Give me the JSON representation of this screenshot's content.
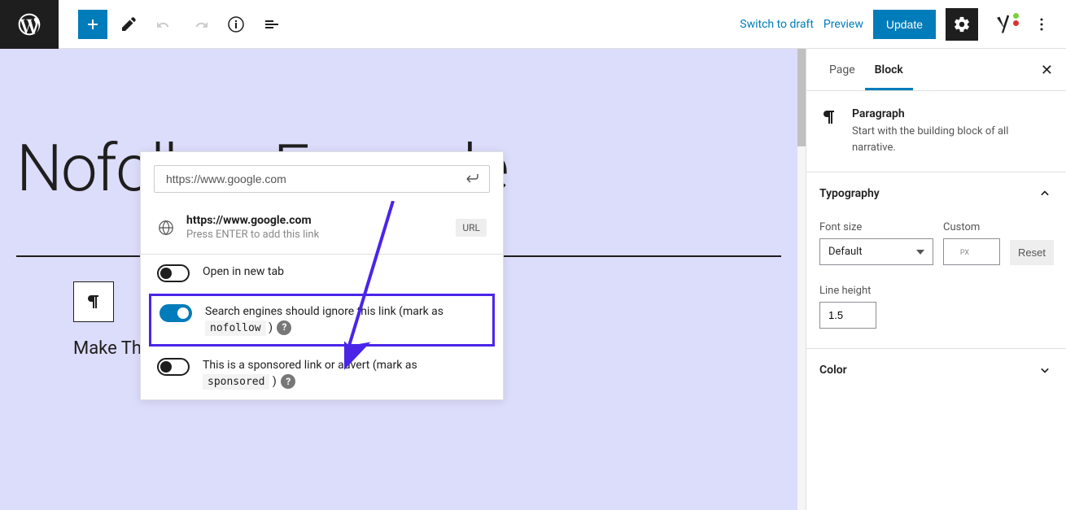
{
  "toolbar": {
    "switch_to_draft": "Switch to draft",
    "preview": "Preview",
    "update": "Update"
  },
  "canvas": {
    "title": "Nofollow Example",
    "content_text": "Make This Nofollow"
  },
  "link_popover": {
    "url_input": "https://www.google.com",
    "preview_title": "https://www.google.com",
    "preview_sub": "Press ENTER to add this link",
    "url_badge": "URL",
    "open_new_tab": "Open in new tab",
    "nofollow_text": "Search engines should ignore this link (mark as ",
    "nofollow_code": "nofollow",
    "nofollow_close": " )",
    "sponsored_text": "This is a sponsored link or advert (mark as ",
    "sponsored_code": "sponsored",
    "sponsored_close": " )"
  },
  "sidebar": {
    "tab_page": "Page",
    "tab_block": "Block",
    "block_name": "Paragraph",
    "block_desc": "Start with the building block of all narrative.",
    "typography": {
      "title": "Typography",
      "font_size_label": "Font size",
      "font_size_value": "Default",
      "custom_label": "Custom",
      "px": "PX",
      "reset": "Reset",
      "line_height_label": "Line height",
      "line_height_value": "1.5"
    },
    "color": {
      "title": "Color"
    }
  }
}
